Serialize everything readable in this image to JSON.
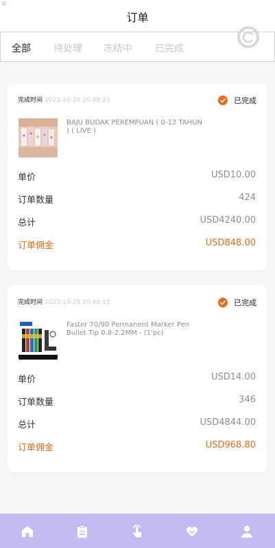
{
  "header": {
    "title": "订单",
    "corner_mark": "©"
  },
  "tabs": [
    {
      "label": "全部",
      "active": true
    },
    {
      "label": "待处理",
      "active": false
    },
    {
      "label": "冻结中",
      "active": false
    },
    {
      "label": "已完成",
      "active": false
    }
  ],
  "orders": [
    {
      "time_label": "完成时间",
      "time_value": "2023-10-29 20:48:23",
      "status": "已完成",
      "product_name": "BAJU BUDAK PEREMPUAN ( 0-12 TAHUN ) ( LIVE )",
      "rows": [
        {
          "label": "单价",
          "value": "USD10.00"
        },
        {
          "label": "订单数量",
          "value": "424"
        },
        {
          "label": "总计",
          "value": "USD4240.00"
        },
        {
          "label": "订单佣金",
          "value": "USD848.00"
        }
      ]
    },
    {
      "time_label": "完成时间",
      "time_value": "2023-10-29 20:40:13",
      "status": "已完成",
      "product_name": "Faster 70/90 Permanent Marker Pen Bullet Tip 0.8-2.2MM - (1'pc)",
      "rows": [
        {
          "label": "单价",
          "value": "USD14.00"
        },
        {
          "label": "订单数量",
          "value": "346"
        },
        {
          "label": "总计",
          "value": "USD4844.00"
        },
        {
          "label": "订单佣金",
          "value": "USD968.80"
        }
      ]
    }
  ],
  "bottom_nav": [
    "home-icon",
    "clipboard-icon",
    "tap-hand-icon",
    "heart-icon",
    "user-icon"
  ],
  "colors": {
    "accent": "#e76a19",
    "nav_bg": "#c5b9f1"
  }
}
